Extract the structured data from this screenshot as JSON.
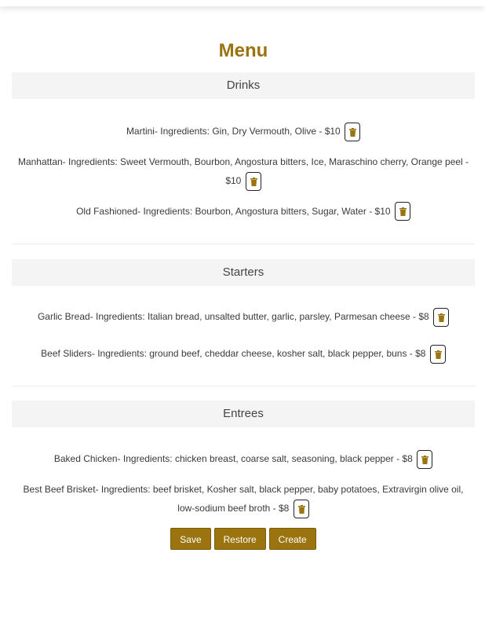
{
  "menu": {
    "title": "Menu",
    "sections": [
      {
        "name": "Drinks",
        "items": [
          {
            "text": "Martini- Ingredients: Gin, Dry Vermouth, Olive - $10"
          },
          {
            "text": "Manhattan- Ingredients: Sweet Vermouth, Bourbon, Angostura bitters, Ice, Maraschino cherry, Orange peel - $10"
          },
          {
            "text": "Old Fashioned- Ingredients: Bourbon, Angostura bitters, Sugar, Water - $10"
          }
        ]
      },
      {
        "name": "Starters",
        "items": [
          {
            "text": "Garlic Bread- Ingredients: Italian bread, unsalted butter, garlic, parsley, Parmesan cheese - $8"
          },
          {
            "text": "Beef Sliders- Ingredients: ground beef, cheddar cheese, kosher salt, black pepper, buns - $8"
          }
        ]
      },
      {
        "name": "Entrees",
        "items": [
          {
            "text": "Baked Chicken- Ingredients: chicken breast, coarse salt, seasoning, black pepper - $8"
          },
          {
            "text": "Best Beef Brisket- Ingredients: beef brisket, Kosher salt, black pepper, baby potatoes, Extravirgin olive oil, low-sodium beef broth - $8"
          }
        ]
      }
    ],
    "delete_icon": "trash-icon"
  },
  "actions": {
    "save_label": "Save",
    "restore_label": "Restore",
    "create_label": "Create"
  },
  "colors": {
    "accent": "#9b7410",
    "section_bg": "#f4f4f4"
  }
}
